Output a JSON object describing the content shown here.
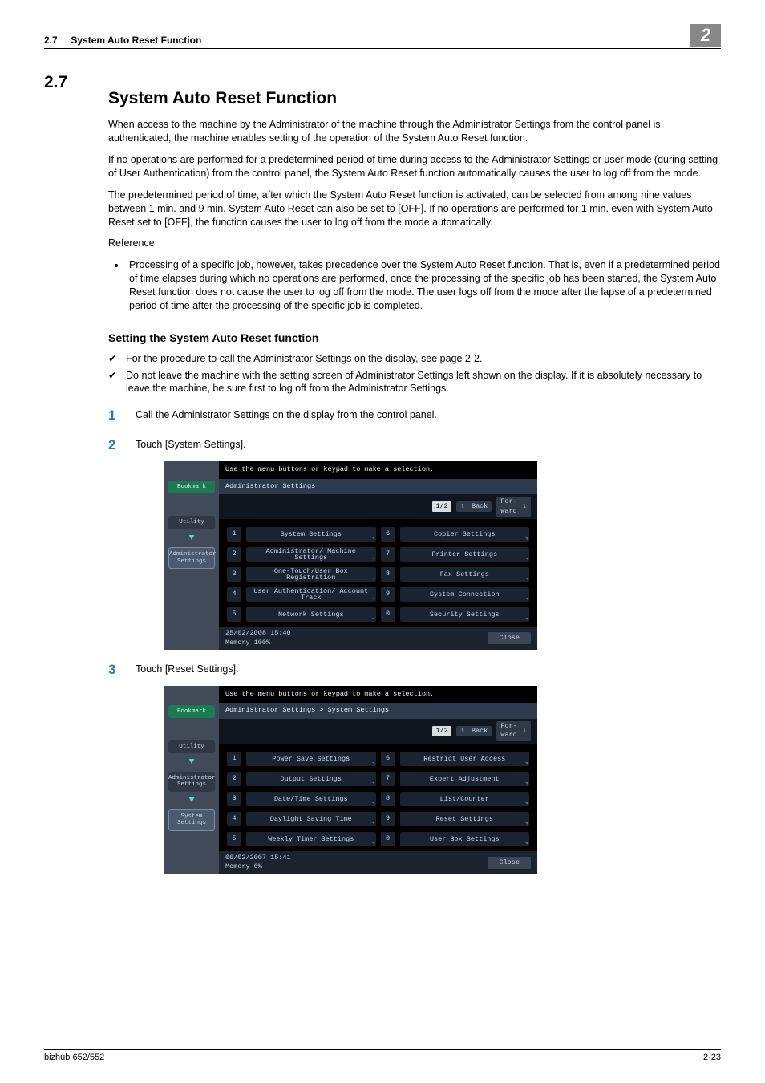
{
  "header": {
    "section_ref": "2.7",
    "section_title_short": "System Auto Reset Function",
    "chapter_num": "2"
  },
  "title": {
    "num": "2.7",
    "text": "System Auto Reset Function"
  },
  "intro": {
    "p1": "When access to the machine by the Administrator of the machine through the Administrator Settings from the control panel is authenticated, the machine enables setting of the operation of the System Auto Reset function.",
    "p2": "If no operations are performed for a predetermined period of time during access to the Administrator Settings or user mode (during setting of User Authentication) from the control panel, the System Auto Reset function automatically causes the user to log off from the mode.",
    "p3": "The predetermined period of time, after which the System Auto Reset function is activated, can be selected from among nine values between 1 min. and 9 min. System Auto Reset can also be set to [OFF]. If no operations are performed for 1 min. even with System Auto Reset set to [OFF], the function causes the user to log off from the mode automatically.",
    "ref_label": "Reference",
    "ref_item": "Processing of a specific job, however, takes precedence over the System Auto Reset function. That is, even if a predetermined period of time elapses during which no operations are performed, once the processing of the specific job has been started, the System Auto Reset function does not cause the user to log off from the mode. The user logs off from the mode after the lapse of a predetermined period of time after the processing of the specific job is completed."
  },
  "sub_heading": "Setting the System Auto Reset function",
  "checks": [
    "For the procedure to call the Administrator Settings on the display, see page 2-2.",
    "Do not leave the machine with the setting screen of Administrator Settings left shown on the display. If it is absolutely necessary to leave the machine, be sure first to log off from the Administrator Settings."
  ],
  "steps": [
    {
      "n": "1",
      "t": "Call the Administrator Settings on the display from the control panel."
    },
    {
      "n": "2",
      "t": "Touch [System Settings]."
    },
    {
      "n": "3",
      "t": "Touch [Reset Settings]."
    }
  ],
  "panel1": {
    "top": "Use the menu buttons or keypad to make a selection.",
    "hdr": "Administrator Settings",
    "page": "1/2",
    "back": "Back",
    "fwd": "Forward",
    "side": {
      "bookmark": "Bookmark",
      "utility": "Utility",
      "admin": "Administrator Settings"
    },
    "opts": [
      {
        "n": "1",
        "l": "System Settings"
      },
      {
        "n": "6",
        "l": "Copier Settings"
      },
      {
        "n": "2",
        "l": "Administrator/ Machine Settings"
      },
      {
        "n": "7",
        "l": "Printer Settings"
      },
      {
        "n": "3",
        "l": "One-Touch/User Box Registration"
      },
      {
        "n": "8",
        "l": "Fax Settings"
      },
      {
        "n": "4",
        "l": "User Authentication/ Account Track"
      },
      {
        "n": "9",
        "l": "System Connection"
      },
      {
        "n": "5",
        "l": "Network Settings"
      },
      {
        "n": "0",
        "l": "Security Settings"
      }
    ],
    "foot_l1": "25/02/2008   15:40",
    "foot_l2": "Memory       100%",
    "close": "Close"
  },
  "panel2": {
    "top": "Use the menu buttons or keypad to make a selection.",
    "hdr": "Administrator Settings > System Settings",
    "page": "1/2",
    "back": "Back",
    "fwd": "Forward",
    "side": {
      "bookmark": "Bookmark",
      "utility": "Utility",
      "admin": "Administrator Settings",
      "sys": "System Settings"
    },
    "opts": [
      {
        "n": "1",
        "l": "Power Save Settings"
      },
      {
        "n": "6",
        "l": "Restrict User Access"
      },
      {
        "n": "2",
        "l": "Output Settings"
      },
      {
        "n": "7",
        "l": "Expert Adjustment"
      },
      {
        "n": "3",
        "l": "Date/Time Settings"
      },
      {
        "n": "8",
        "l": "List/Counter"
      },
      {
        "n": "4",
        "l": "Daylight Saving Time"
      },
      {
        "n": "9",
        "l": "Reset Settings"
      },
      {
        "n": "5",
        "l": "Weekly Timer Settings"
      },
      {
        "n": "0",
        "l": "User Box Settings"
      }
    ],
    "foot_l1": "06/02/2007   15:41",
    "foot_l2": "Memory        0%",
    "close": "Close"
  },
  "footer": {
    "left": "bizhub 652/552",
    "right": "2-23"
  }
}
